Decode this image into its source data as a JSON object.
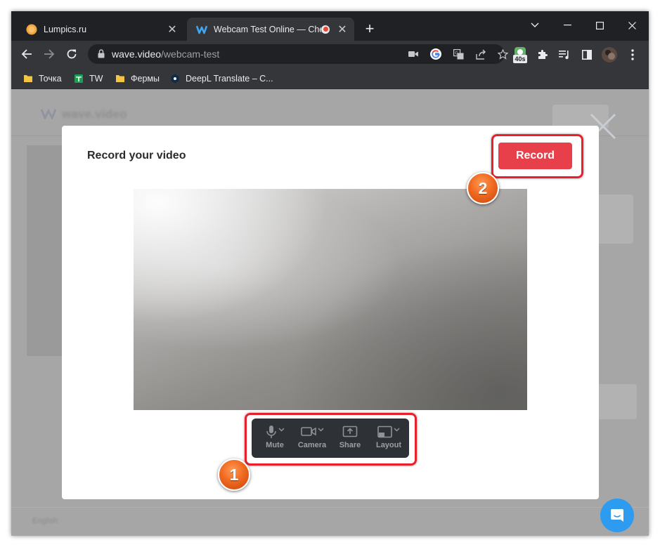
{
  "browser": {
    "tabs": [
      {
        "title": "Lumpics.ru",
        "active": false
      },
      {
        "title": "Webcam Test Online — Chec",
        "active": true,
        "recording": true
      }
    ],
    "new_tab_label": "+",
    "address": {
      "domain": "wave.video",
      "path": "/webcam-test"
    },
    "extension_badge": "40s",
    "bookmarks": [
      {
        "label": "Точка",
        "icon": "folder-icon"
      },
      {
        "label": "TW",
        "icon": "sheets-icon"
      },
      {
        "label": "Фермы",
        "icon": "folder-icon"
      },
      {
        "label": "DeepL Translate – C...",
        "icon": "deepl-icon"
      }
    ]
  },
  "page": {
    "logo": "wave.video",
    "language": "English"
  },
  "modal": {
    "title": "Record your video",
    "record_label": "Record",
    "controls": [
      {
        "label": "Mute",
        "icon": "microphone-icon",
        "dropdown": true
      },
      {
        "label": "Camera",
        "icon": "camera-icon",
        "dropdown": true
      },
      {
        "label": "Share",
        "icon": "share-screen-icon",
        "dropdown": false
      },
      {
        "label": "Layout",
        "icon": "layout-icon",
        "dropdown": true
      }
    ]
  },
  "annotations": {
    "badge_1": "1",
    "badge_2": "2"
  },
  "colors": {
    "record_button": "#e8404a",
    "highlight": "#e8202c",
    "badge": "#f06a21",
    "chat": "#2d9bf0"
  }
}
